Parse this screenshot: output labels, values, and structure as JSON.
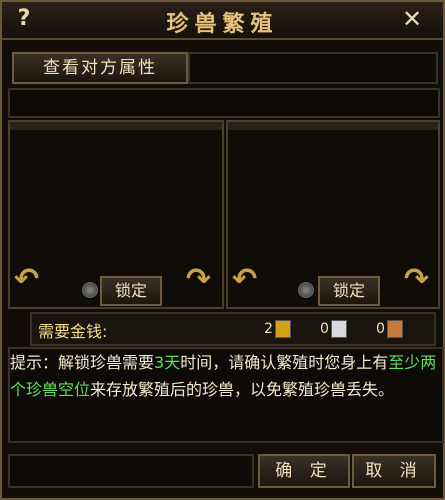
{
  "window": {
    "title": "珍兽繁殖",
    "help_icon": "?",
    "close_icon": "✕"
  },
  "actions": {
    "view_attributes": "查看对方属性",
    "lock": "锁定",
    "confirm": "确 定",
    "cancel": "取 消"
  },
  "money": {
    "label": "需要金钱:",
    "gold": "2",
    "silver": "0",
    "copper": "0",
    "colors": {
      "gold": "#d4a017",
      "silver": "#d9d9d9",
      "copper": "#c47a3a"
    }
  },
  "tip": {
    "p1": "提示：解锁珍兽需要",
    "h1": "3天",
    "p2": "时间，请确认繁殖时您身上有",
    "h2": "至少两个珍兽空位",
    "p3": "来存放繁殖后的珍兽，以免繁殖珍兽丢失。"
  }
}
